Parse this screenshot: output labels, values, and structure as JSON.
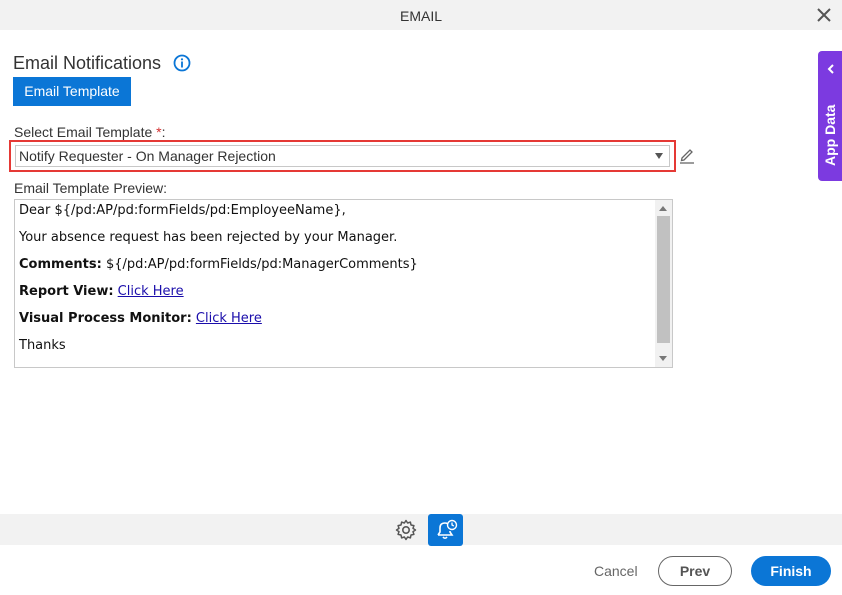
{
  "window": {
    "title": "EMAIL",
    "close_icon": "close-icon"
  },
  "section": {
    "title": "Email Notifications",
    "info_icon": "info-icon"
  },
  "tabs": {
    "email_template": "Email Template"
  },
  "form": {
    "select_label": "Select Email Template",
    "required_mark": "*",
    "select_label_suffix": ":",
    "selected_template": "Notify Requester - On Manager Rejection",
    "edit_icon": "pencil-icon",
    "preview_label": "Email Template Preview:"
  },
  "preview": {
    "greeting": "Dear ${/pd:AP/pd:formFields/pd:EmployeeName},",
    "message": "Your absence request has been rejected by your Manager.",
    "comments_label": "Comments:",
    "comments_value": "${/pd:AP/pd:formFields/pd:ManagerComments}",
    "report_label": "Report View:",
    "report_link": "Click Here",
    "monitor_label": "Visual Process Monitor:",
    "monitor_link": "Click Here",
    "closing": "Thanks"
  },
  "side_panel": {
    "label": "App Data",
    "chevron_icon": "chevron-left-icon"
  },
  "toolbar": {
    "gear_icon": "gear-icon",
    "bell_icon": "bell-clock-icon"
  },
  "footer": {
    "cancel": "Cancel",
    "prev": "Prev",
    "finish": "Finish"
  },
  "colors": {
    "accent": "#0b76d6",
    "side_tab": "#7c3ae0",
    "required": "#d32f2f",
    "highlight_border": "#e53935"
  }
}
